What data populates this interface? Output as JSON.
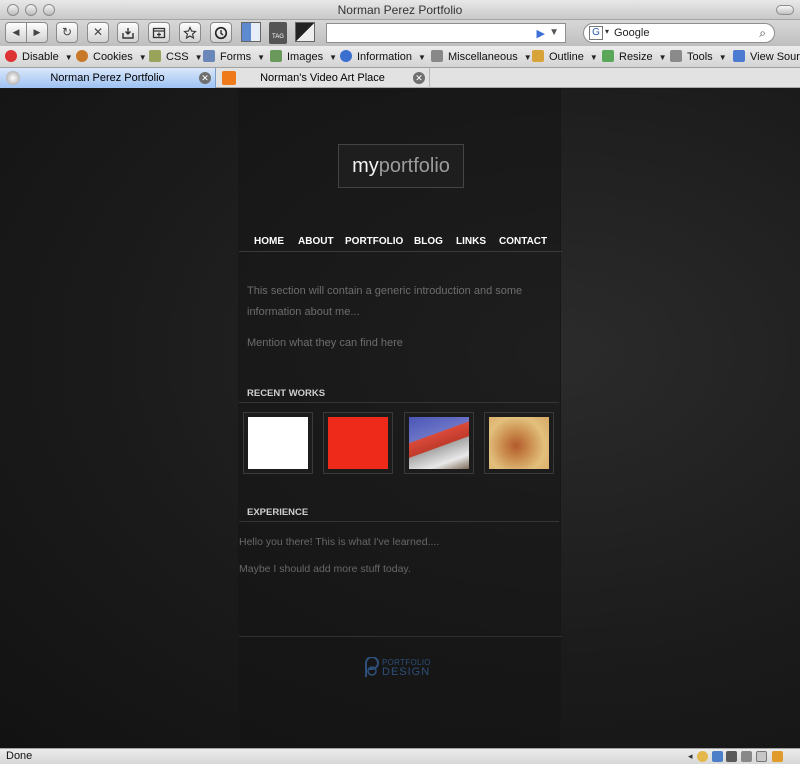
{
  "window": {
    "title": "Norman Perez Portfolio"
  },
  "navbar": {
    "back_glyph": "◀",
    "forward_glyph": "▶",
    "reload_glyph": "↻",
    "stop_glyph": "✕",
    "url": "",
    "go_glyph": "▶",
    "url_dropdown_glyph": "▼",
    "search_engine_glyph": "G",
    "search_engine_menu_glyph": "▾",
    "search_text": "Google",
    "search_icon_glyph": "⌕"
  },
  "devbar": {
    "items": [
      {
        "label": "Disable",
        "icon_color": "#d33"
      },
      {
        "label": "Cookies",
        "icon_color": "#c9782a"
      },
      {
        "label": "CSS",
        "icon_color": "#9aa35a"
      },
      {
        "label": "Forms",
        "icon_color": "#6b86b8"
      },
      {
        "label": "Images",
        "icon_color": "#6a9a5b"
      },
      {
        "label": "Information",
        "icon_color": "#3a6fcf"
      },
      {
        "label": "Miscellaneous",
        "icon_color": "#888"
      },
      {
        "label": "Outline",
        "icon_color": "#d8a338"
      },
      {
        "label": "Resize",
        "icon_color": "#5aa65a"
      },
      {
        "label": "Tools",
        "icon_color": "#8a8a8a"
      },
      {
        "label": "View Sourc",
        "icon_color": "#4b7bd1"
      }
    ],
    "dropdown_glyph": "▼"
  },
  "tabs": [
    {
      "label": "Norman Perez Portfolio",
      "active": true
    },
    {
      "label": "Norman's Video Art Place",
      "active": false
    }
  ],
  "tab_close_glyph": "✕",
  "site": {
    "logo_my": "my",
    "logo_rest": "portfolio",
    "menu": [
      "HOME",
      "ABOUT",
      "PORTFOLIO",
      "BLOG",
      "LINKS",
      "CONTACT"
    ],
    "intro_line1": "This section will contain a generic introduction and some information about me...",
    "intro_line2": "Mention what they can find here",
    "recent_works_heading": "RECENT WORKS",
    "experience_heading": "EXPERIENCE",
    "experience_line1": "Hello you there! This is what I've learned....",
    "experience_line2": "Maybe I should add more stuff today.",
    "footer_logo_top": "PORTFOLIO",
    "footer_logo_bottom": "DESIGN",
    "thumb_colors": [
      "#ffffff",
      "#ee2a1b",
      "#5b62b8",
      "#d8a35a"
    ]
  },
  "status": {
    "text": "Done"
  }
}
